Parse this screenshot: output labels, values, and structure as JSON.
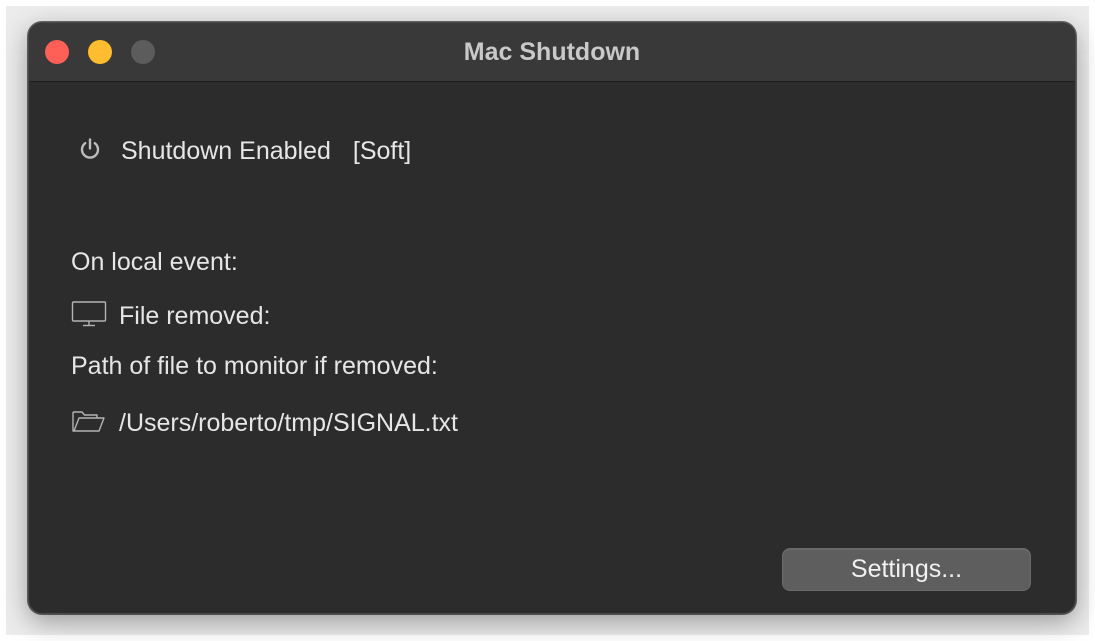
{
  "window": {
    "title": "Mac Shutdown"
  },
  "status": {
    "icon": "power-icon",
    "label": "Shutdown Enabled",
    "mode": "[Soft]"
  },
  "local_event": {
    "heading": "On local event:",
    "trigger_icon": "monitor-icon",
    "trigger_label": "File removed:",
    "path_label": "Path of file to monitor if removed:",
    "path_icon": "folder-open-icon",
    "path_value": "/Users/roberto/tmp/SIGNAL.txt"
  },
  "footer": {
    "settings_label": "Settings..."
  },
  "colors": {
    "close": "#fe5f57",
    "minimize": "#febc2e",
    "zoom_inactive": "#5c5c5c",
    "window_bg": "#2c2c2c",
    "titlebar_bg": "#393939"
  }
}
